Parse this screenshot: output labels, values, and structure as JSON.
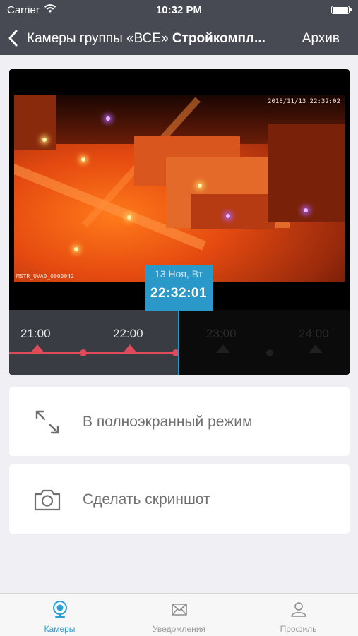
{
  "status_bar": {
    "carrier": "Carrier",
    "time": "10:32 PM"
  },
  "nav": {
    "title_prefix": "Камеры группы «ВСЕ» ",
    "title_bold": "Стройкомпл...",
    "archive_label": "Архив"
  },
  "video": {
    "timestamp": "2018/11/13 22:32:02",
    "camera_id": "MSTR_UVA0_0000042"
  },
  "date_badge": {
    "date": "13 Ноя, Вт",
    "time": "22:32:01"
  },
  "timeline": {
    "labels": [
      "21:00",
      "22:00",
      "23:00",
      "24:00"
    ]
  },
  "actions": {
    "fullscreen": "В полноэкранный режим",
    "screenshot": "Сделать скриншот"
  },
  "tabs": [
    {
      "label": "Камеры",
      "icon": "camera-icon"
    },
    {
      "label": "Уведомления",
      "icon": "envelope-icon"
    },
    {
      "label": "Профиль",
      "icon": "profile-icon"
    }
  ],
  "colors": {
    "accent": "#2b9fd8",
    "nav_bg": "#474a52",
    "timeline_red": "#e04a5a"
  }
}
